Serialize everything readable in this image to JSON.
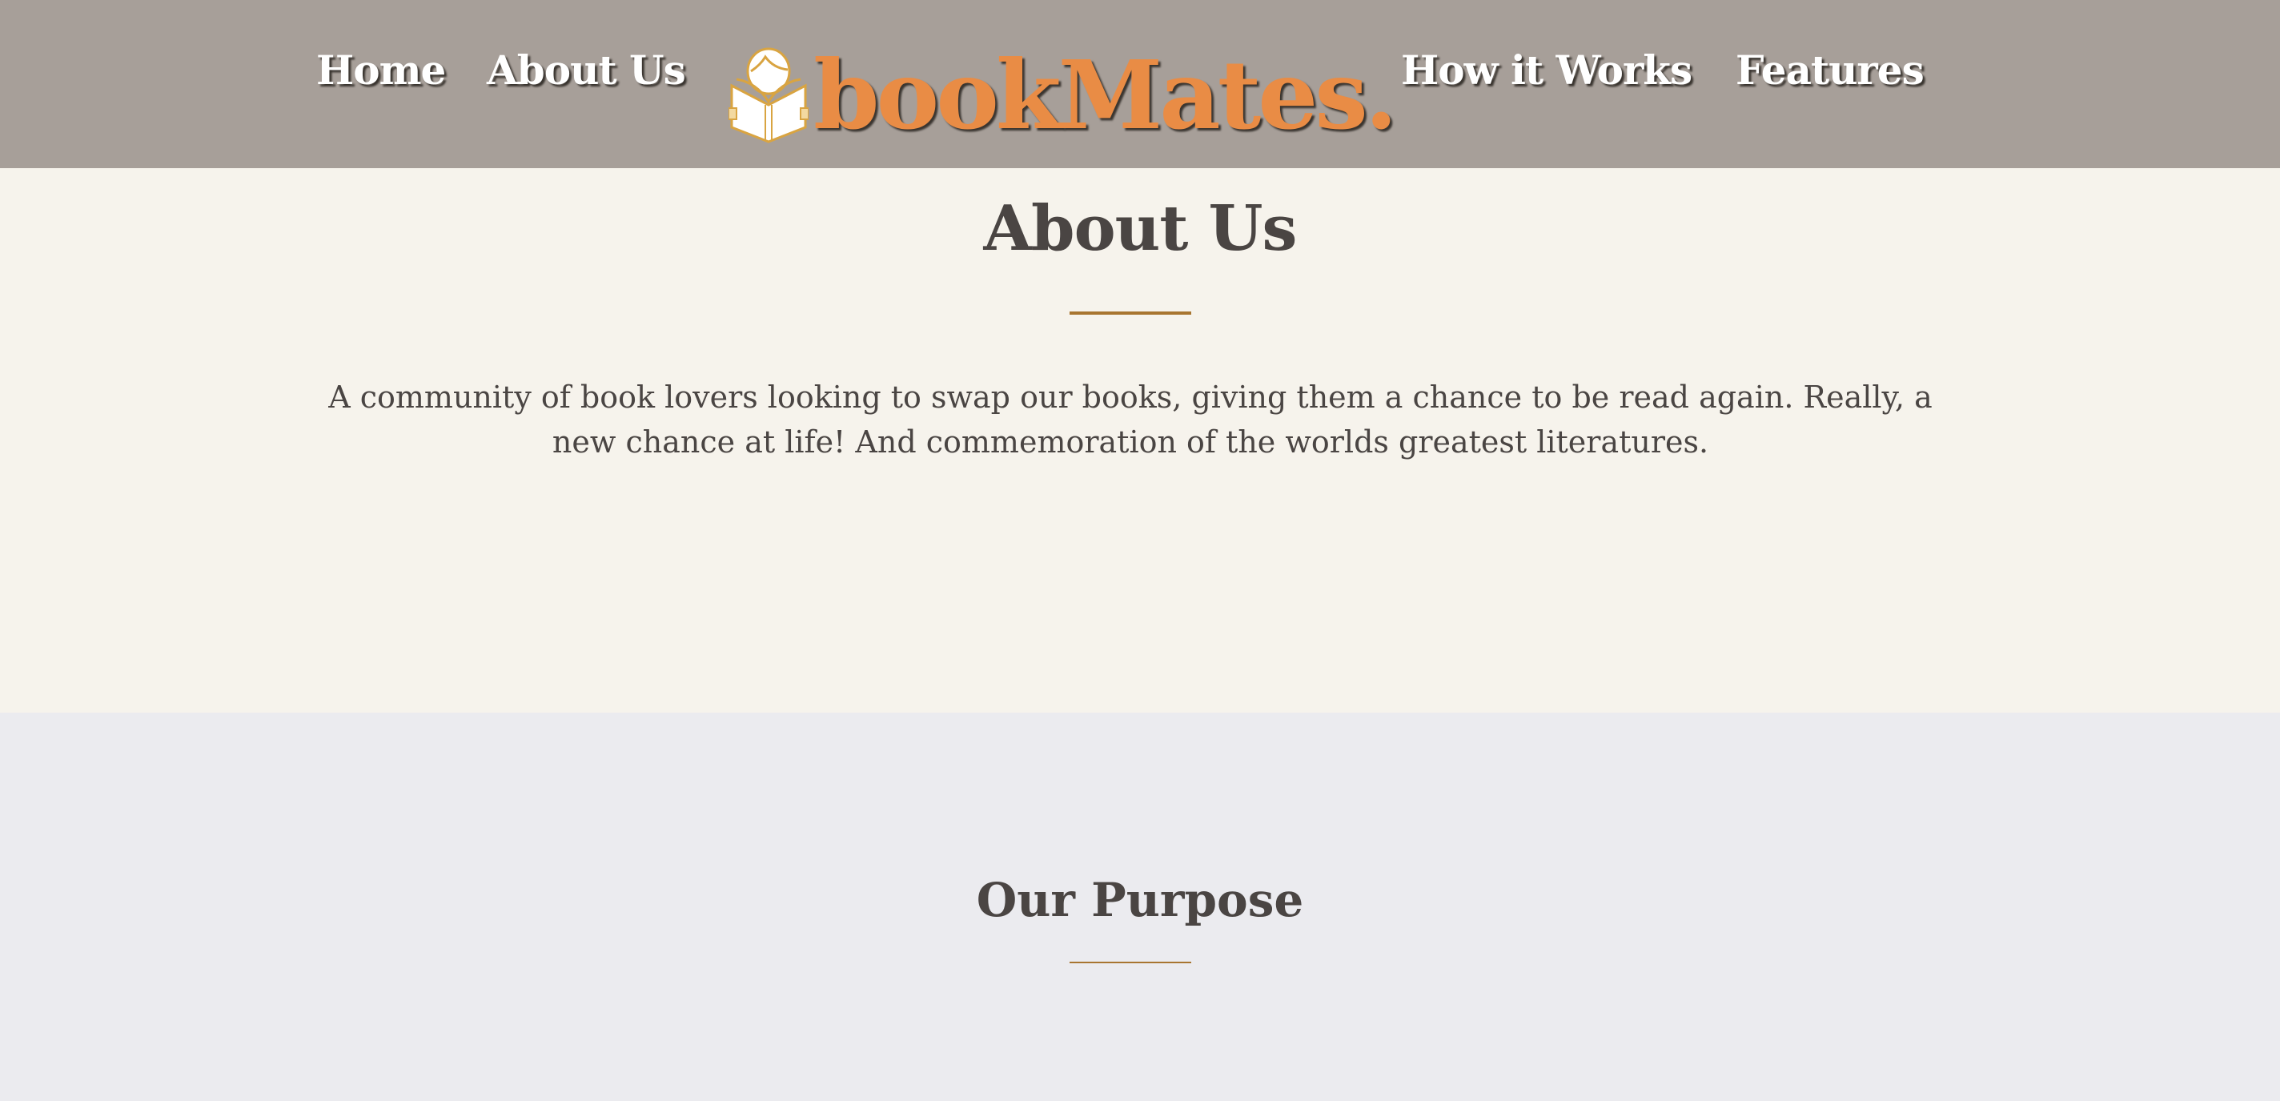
{
  "nav": {
    "items": [
      {
        "label": "Home"
      },
      {
        "label": "About Us"
      },
      {
        "label": "How it Works"
      },
      {
        "label": "Features"
      }
    ],
    "logo": {
      "text": "bookMates.",
      "icon": "reader-book-icon"
    }
  },
  "about": {
    "title": "About Us",
    "description": "A community of book lovers looking to swap our books, giving them a chance to be read again. Really, a new chance at life! And commemoration of the worlds greatest literatures."
  },
  "purpose": {
    "title": "Our Purpose"
  },
  "colors": {
    "nav_bg": "#a79f99",
    "brand": "#e98c45",
    "accent_rule": "#a87530",
    "section1_bg": "#f6f3ec",
    "section2_bg": "#ebebef",
    "text": "#4a4543"
  }
}
